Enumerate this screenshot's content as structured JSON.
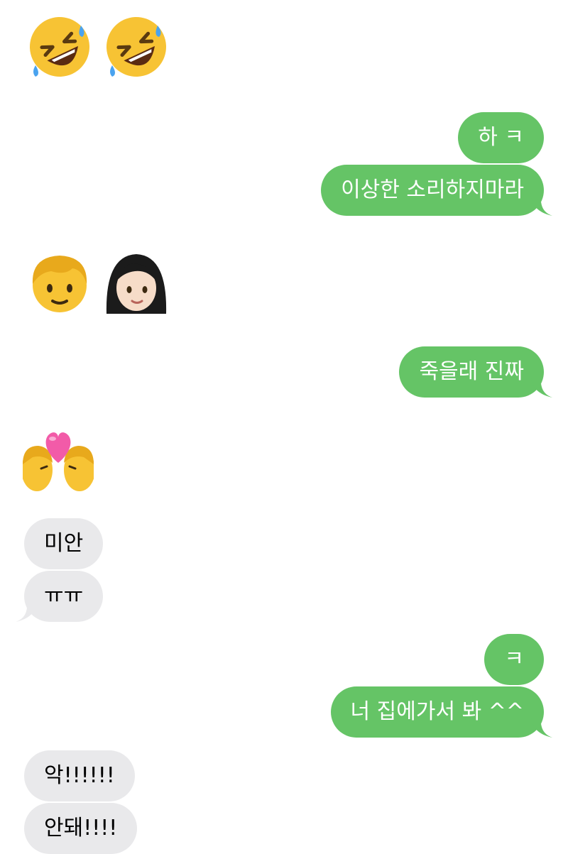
{
  "colors": {
    "sent_bubble": "#65c466",
    "received_bubble": "#e9e9eb"
  },
  "messages": [
    {
      "from": "them",
      "kind": "emoji",
      "icons": [
        "rolling-on-floor-laughing-emoji",
        "rolling-on-floor-laughing-emoji"
      ]
    },
    {
      "from": "me",
      "kind": "text",
      "text": "하 ㅋ"
    },
    {
      "from": "me",
      "kind": "text",
      "text": "이상한 소리하지마라"
    },
    {
      "from": "them",
      "kind": "emoji",
      "icons": [
        "child-emoji",
        "woman-emoji"
      ]
    },
    {
      "from": "me",
      "kind": "text",
      "text": "죽을래 진짜"
    },
    {
      "from": "them",
      "kind": "emoji",
      "icons": [
        "kiss-emoji"
      ]
    },
    {
      "from": "them",
      "kind": "text",
      "text": "미안"
    },
    {
      "from": "them",
      "kind": "text",
      "text": "ㅠㅠ"
    },
    {
      "from": "me",
      "kind": "text",
      "text": "ㅋ"
    },
    {
      "from": "me",
      "kind": "text",
      "text": "너 집에가서 봐 ^^"
    },
    {
      "from": "them",
      "kind": "text",
      "text": "악!!!!!!"
    },
    {
      "from": "them",
      "kind": "text",
      "text": "안돼!!!!"
    }
  ]
}
